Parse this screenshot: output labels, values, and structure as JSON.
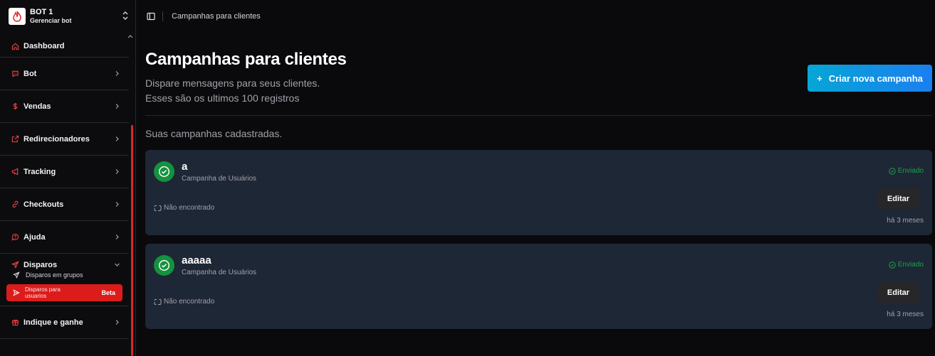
{
  "brand": {
    "name": "BOT 1",
    "subtitle": "Gerenciar bot"
  },
  "sidebar": {
    "items": [
      {
        "label": "Dashboard",
        "icon": "home-icon"
      },
      {
        "label": "Bot",
        "icon": "chat-bot-icon"
      },
      {
        "label": "Vendas",
        "icon": "dollar-icon"
      },
      {
        "label": "Redirecionadores",
        "icon": "external-link-icon"
      },
      {
        "label": "Tracking",
        "icon": "megaphone-icon"
      },
      {
        "label": "Checkouts",
        "icon": "link-icon"
      },
      {
        "label": "Ajuda",
        "icon": "help-bubble-icon"
      },
      {
        "label": "Disparos",
        "icon": "send-icon"
      },
      {
        "label": "Indique e ganhe",
        "icon": "gift-icon"
      }
    ],
    "disparos_sub": {
      "groups_label": "Disparos em grupos",
      "users_label": "Disparos para usuarios",
      "users_badge": "Beta"
    }
  },
  "topbar": {
    "breadcrumb": "Campanhas para clientes"
  },
  "page": {
    "title": "Campanhas para clientes",
    "description_line1": "Dispare mensagens para seus clientes.",
    "description_line2": "Esses são os ultimos 100 registros",
    "new_button": "Criar nova campanha",
    "section_label": "Suas campanhas cadastradas."
  },
  "campaigns": [
    {
      "name": "a",
      "type": "Campanha de Usuários",
      "status": "Enviado",
      "media": "Não encontrado",
      "edit_label": "Editar",
      "time": "há 3 meses"
    },
    {
      "name": "aaaaa",
      "type": "Campanha de Usuários",
      "status": "Enviado",
      "media": "Não encontrado",
      "edit_label": "Editar",
      "time": "há 3 meses"
    }
  ],
  "colors": {
    "accent_red": "#dc1b1b",
    "button_gradient_start": "#06a6d6",
    "button_gradient_end": "#1a7ff0",
    "success": "#16a34a",
    "card_bg": "#1e2735"
  }
}
